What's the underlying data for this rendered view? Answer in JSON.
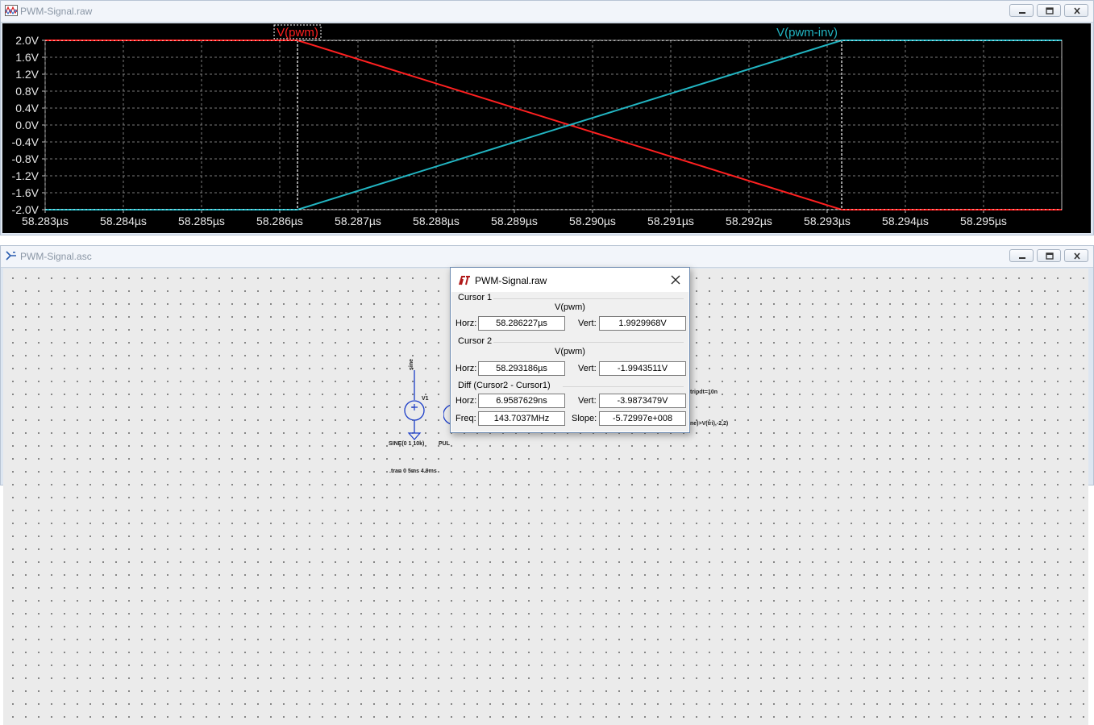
{
  "waveform_window": {
    "title": "PWM-Signal.raw",
    "icon": "waveform-app-icon"
  },
  "schematic_window": {
    "title": "PWM-Signal.asc",
    "icon": "schematic-app-icon",
    "labels": {
      "net_sine": "sine",
      "v1_ref": "V1",
      "v1_value": "SINE(0 1 10k)",
      "v2_value_partial": "PUL",
      "tran_directive": ".tran 0 5ms 4.9ms",
      "tripdt_text": "tripdt=10n",
      "expr_text": "ne)>V(tri),-2,2)"
    }
  },
  "window_buttons": {
    "minimize": "minimize-icon",
    "restore": "restore-icon",
    "close": "close-icon"
  },
  "chart_data": {
    "type": "line",
    "title": "",
    "xlabel": "",
    "ylabel": "",
    "xlim": [
      58.283,
      58.296
    ],
    "ylim": [
      -2.0,
      2.0
    ],
    "x_ticks": [
      58.283,
      58.284,
      58.285,
      58.286,
      58.287,
      58.288,
      58.289,
      58.29,
      58.291,
      58.292,
      58.293,
      58.294,
      58.295
    ],
    "x_tick_labels": [
      "58.283µs",
      "58.284µs",
      "58.285µs",
      "58.286µs",
      "58.287µs",
      "58.288µs",
      "58.289µs",
      "58.290µs",
      "58.291µs",
      "58.292µs",
      "58.293µs",
      "58.294µs",
      "58.295µs"
    ],
    "y_ticks": [
      2.0,
      1.6,
      1.2,
      0.8,
      0.4,
      0.0,
      -0.4,
      -0.8,
      -1.2,
      -1.6,
      -2.0
    ],
    "y_tick_labels": [
      "2.0V",
      "1.6V",
      "1.2V",
      "0.8V",
      "0.4V",
      "0.0V",
      "-0.4V",
      "-0.8V",
      "-1.2V",
      "-1.6V",
      "-2.0V"
    ],
    "grid": true,
    "series": [
      {
        "name": "V(pwm)",
        "color": "#ff2020",
        "x": [
          58.283,
          58.286227,
          58.293186,
          58.296
        ],
        "y": [
          2.0,
          2.0,
          -2.0,
          -2.0
        ]
      },
      {
        "name": "V(pwm-inv)",
        "color": "#22b5c2",
        "x": [
          58.283,
          58.286227,
          58.293186,
          58.296
        ],
        "y": [
          -2.0,
          -2.0,
          2.0,
          2.0
        ]
      }
    ],
    "cursors": [
      {
        "x": 58.286227,
        "y": 1.9929968
      },
      {
        "x": 58.293186,
        "y": -1.9943511
      }
    ],
    "colors": {
      "background": "#000000",
      "grid": "#7a7a7a",
      "axis_text": "#e6e6e6",
      "cursor": "#ffffff"
    }
  },
  "cursor_dialog": {
    "title": "PWM-Signal.raw",
    "icon": "lt-logo-icon",
    "close_icon": "close-icon",
    "cursor1": {
      "group": "Cursor 1",
      "trace": "V(pwm)",
      "horz_label": "Horz:",
      "horz_value": "58.286227µs",
      "vert_label": "Vert:",
      "vert_value": "1.9929968V"
    },
    "cursor2": {
      "group": "Cursor 2",
      "trace": "V(pwm)",
      "horz_label": "Horz:",
      "horz_value": "58.293186µs",
      "vert_label": "Vert:",
      "vert_value": "-1.9943511V"
    },
    "diff": {
      "group": "Diff (Cursor2 - Cursor1)",
      "horz_label": "Horz:",
      "horz_value": "6.9587629ns",
      "vert_label": "Vert:",
      "vert_value": "-3.9873479V",
      "freq_label": "Freq:",
      "freq_value": "143.7037MHz",
      "slope_label": "Slope:",
      "slope_value": "-5.72997e+008"
    }
  }
}
